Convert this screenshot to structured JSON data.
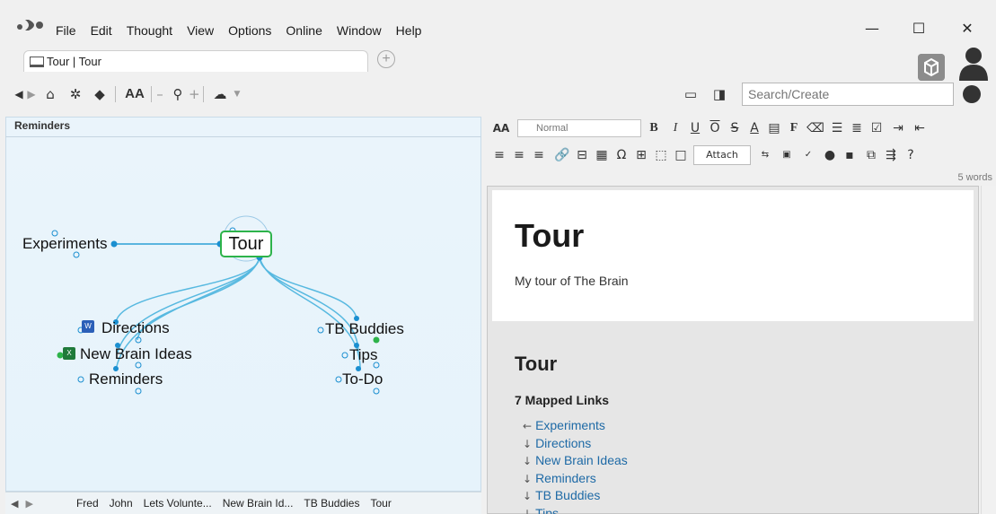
{
  "menubar": {
    "items": [
      "File",
      "Edit",
      "Thought",
      "View",
      "Options",
      "Online",
      "Window",
      "Help"
    ]
  },
  "window_controls": {
    "minimize": "—",
    "maximize": "☐",
    "close": "✕"
  },
  "tab": {
    "label": "Tour | Tour"
  },
  "search": {
    "placeholder": "Search/Create"
  },
  "plex": {
    "header": "Reminders",
    "active_thought": "Tour",
    "parents": [
      "Experiments"
    ],
    "children_left": [
      "Directions",
      "New Brain Ideas",
      "Reminders"
    ],
    "children_right": [
      "TB Buddies",
      "Tips",
      "To-Do"
    ]
  },
  "bottombar": {
    "pins": [
      "Fred",
      "John",
      "Lets Volunte...",
      "New Brain Id...",
      "TB Buddies",
      "Tour"
    ]
  },
  "editor": {
    "style_value": "Normal",
    "attach_label": "Attach",
    "word_count": "5 words"
  },
  "notes": {
    "title": "Tour",
    "body": "My tour of The Brain",
    "section_title": "Tour",
    "links_heading": "7 Mapped Links",
    "links": [
      {
        "arrow": "←",
        "label": "Experiments"
      },
      {
        "arrow": "↓",
        "label": "Directions"
      },
      {
        "arrow": "↓",
        "label": "New Brain Ideas"
      },
      {
        "arrow": "↓",
        "label": "Reminders"
      },
      {
        "arrow": "↓",
        "label": "TB Buddies"
      },
      {
        "arrow": "↓",
        "label": "Tips"
      }
    ]
  },
  "colors": {
    "accent": "#2aa0d6",
    "node_green": "#2db34a",
    "link_blue": "#1e6aa6"
  }
}
